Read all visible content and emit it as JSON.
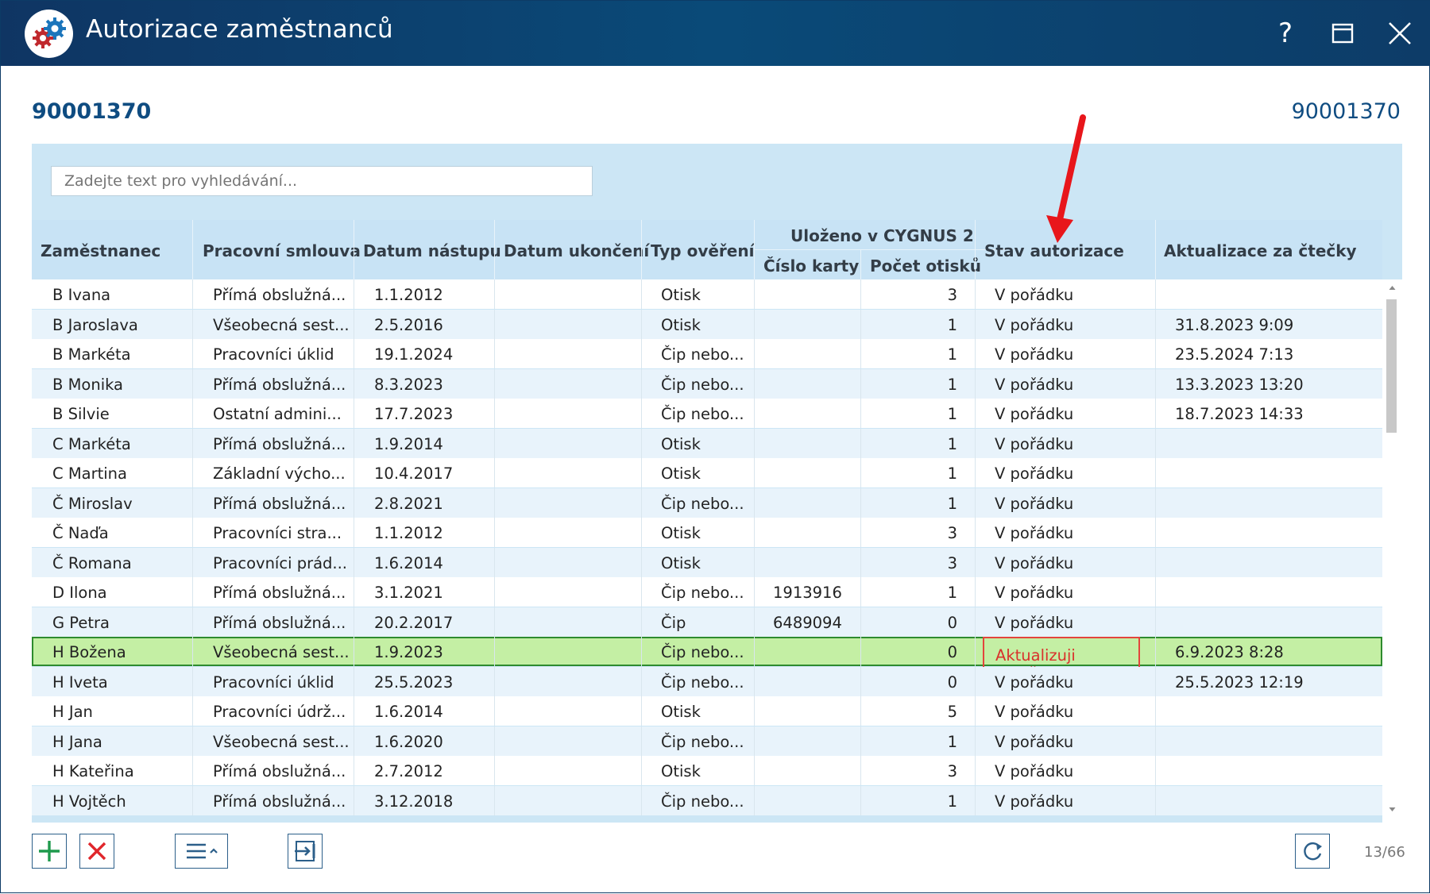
{
  "window": {
    "title": "Autorizace zaměstnanců"
  },
  "titlebar_buttons": {
    "help": "?"
  },
  "header": {
    "left_id": "90001370",
    "right_id": "90001370"
  },
  "search": {
    "placeholder": "Zadejte text pro vyhledávání..."
  },
  "columns": {
    "employee": "Zaměstnanec",
    "contract": "Pracovní smlouva",
    "start_date": "Datum nástupu",
    "end_date": "Datum ukončení",
    "verification": "Typ ověření",
    "cygnus_group": "Uloženo v CYGNUS 2",
    "card_number": "Číslo karty",
    "fingerprints": "Počet otisků",
    "status": "Stav autorizace",
    "reader_update": "Aktualizace za čtečky"
  },
  "rows": [
    {
      "name": "B Ivana",
      "contract": "Přímá obslužná...",
      "start": "1.1.2012",
      "end": "",
      "type": "Otisk",
      "card": "",
      "count": "3",
      "status": "V pořádku",
      "update": ""
    },
    {
      "name": "B Jaroslava",
      "contract": "Všeobecná sest...",
      "start": "2.5.2016",
      "end": "",
      "type": "Otisk",
      "card": "",
      "count": "1",
      "status": "V pořádku",
      "update": "31.8.2023 9:09"
    },
    {
      "name": "B Markéta",
      "contract": "Pracovníci úklid",
      "start": "19.1.2024",
      "end": "",
      "type": "Čip nebo...",
      "card": "",
      "count": "1",
      "status": "V pořádku",
      "update": "23.5.2024 7:13"
    },
    {
      "name": "B Monika",
      "contract": "Přímá obslužná...",
      "start": "8.3.2023",
      "end": "",
      "type": "Čip nebo...",
      "card": "",
      "count": "1",
      "status": "V pořádku",
      "update": "13.3.2023 13:20"
    },
    {
      "name": "B Silvie",
      "contract": "Ostatní admini...",
      "start": "17.7.2023",
      "end": "",
      "type": "Čip nebo...",
      "card": "",
      "count": "1",
      "status": "V pořádku",
      "update": "18.7.2023 14:33"
    },
    {
      "name": "C Markéta",
      "contract": "Přímá obslužná...",
      "start": "1.9.2014",
      "end": "",
      "type": "Otisk",
      "card": "",
      "count": "1",
      "status": "V pořádku",
      "update": ""
    },
    {
      "name": "C Martina",
      "contract": "Základní výcho...",
      "start": "10.4.2017",
      "end": "",
      "type": "Otisk",
      "card": "",
      "count": "1",
      "status": "V pořádku",
      "update": ""
    },
    {
      "name": "Č Miroslav",
      "contract": "Přímá obslužná...",
      "start": "2.8.2021",
      "end": "",
      "type": "Čip nebo...",
      "card": "",
      "count": "1",
      "status": "V pořádku",
      "update": ""
    },
    {
      "name": "Č Naďa",
      "contract": "Pracovníci stra...",
      "start": "1.1.2012",
      "end": "",
      "type": "Otisk",
      "card": "",
      "count": "3",
      "status": "V pořádku",
      "update": ""
    },
    {
      "name": "Č Romana",
      "contract": "Pracovníci prád...",
      "start": "1.6.2014",
      "end": "",
      "type": "Otisk",
      "card": "",
      "count": "3",
      "status": "V pořádku",
      "update": ""
    },
    {
      "name": "D Ilona",
      "contract": "Přímá obslužná...",
      "start": "3.1.2021",
      "end": "",
      "type": "Čip nebo...",
      "card": "1913916",
      "count": "1",
      "status": "V pořádku",
      "update": ""
    },
    {
      "name": "G Petra",
      "contract": "Přímá obslužná...",
      "start": "20.2.2017",
      "end": "",
      "type": "Čip",
      "card": "6489094",
      "count": "0",
      "status": "V pořádku",
      "update": ""
    },
    {
      "name": "H Božena",
      "contract": "Všeobecná sest...",
      "start": "1.9.2023",
      "end": "",
      "type": "Čip nebo...",
      "card": "",
      "count": "0",
      "status": "Aktualizuji zaměst...",
      "update": "6.9.2023 8:28"
    },
    {
      "name": "H Iveta",
      "contract": "Pracovníci úklid",
      "start": "25.5.2023",
      "end": "",
      "type": "Čip nebo...",
      "card": "",
      "count": "0",
      "status": "V pořádku",
      "update": "25.5.2023 12:19"
    },
    {
      "name": "H Jan",
      "contract": "Pracovníci údrž...",
      "start": "1.6.2014",
      "end": "",
      "type": "Otisk",
      "card": "",
      "count": "5",
      "status": "V pořádku",
      "update": ""
    },
    {
      "name": "H Jana",
      "contract": "Všeobecná sest...",
      "start": "1.6.2020",
      "end": "",
      "type": "Čip nebo...",
      "card": "",
      "count": "1",
      "status": "V pořádku",
      "update": ""
    },
    {
      "name": "H Kateřina",
      "contract": "Přímá obslužná...",
      "start": "2.7.2012",
      "end": "",
      "type": "Otisk",
      "card": "",
      "count": "3",
      "status": "V pořádku",
      "update": ""
    },
    {
      "name": "H Vojtěch",
      "contract": "Přímá obslužná...",
      "start": "3.12.2018",
      "end": "",
      "type": "Čip nebo...",
      "card": "",
      "count": "1",
      "status": "V pořádku",
      "update": ""
    }
  ],
  "selected_row_index": 12,
  "footer": {
    "counter": "13/66"
  },
  "colors": {
    "titlebar": "#0a4a78",
    "accent": "#0f4c81",
    "selected_row": "#c4efa4",
    "error_text": "#d9322c",
    "arrow": "#e8161b"
  },
  "icons": [
    "gears-icon",
    "help-icon",
    "maximize-icon",
    "close-icon",
    "add-icon",
    "delete-icon",
    "menu-icon",
    "export-icon",
    "refresh-icon"
  ]
}
